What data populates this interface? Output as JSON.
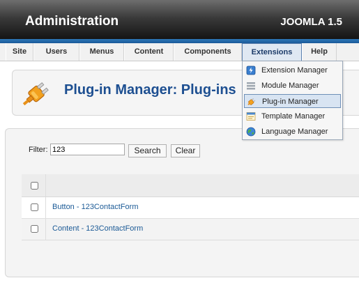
{
  "header": {
    "title": "Administration",
    "version": "JOOMLA 1.5"
  },
  "menu": {
    "items": [
      {
        "label": "Site"
      },
      {
        "label": "Users"
      },
      {
        "label": "Menus"
      },
      {
        "label": "Content"
      },
      {
        "label": "Components"
      },
      {
        "label": "Extensions",
        "active": true
      },
      {
        "label": "Help"
      }
    ]
  },
  "dropdown": {
    "items": [
      {
        "label": "Extension Manager",
        "icon": "extension-manager-icon"
      },
      {
        "label": "Module Manager",
        "icon": "module-manager-icon"
      },
      {
        "label": "Plug-in Manager",
        "icon": "plugin-icon",
        "selected": true
      },
      {
        "label": "Template Manager",
        "icon": "template-manager-icon"
      },
      {
        "label": "Language Manager",
        "icon": "globe-icon"
      }
    ]
  },
  "toolbar": {
    "title": "Plug-in Manager: Plug-ins",
    "icon": "plugin-icon"
  },
  "filter": {
    "label": "Filter:",
    "value": "123",
    "search_label": "Search",
    "clear_label": "Clear"
  },
  "table": {
    "rows": [
      {
        "name": "Button - 123ContactForm"
      },
      {
        "name": "Content - 123ContactForm"
      }
    ]
  },
  "colors": {
    "link": "#1b5a96",
    "title": "#1d4f91",
    "header_strip": "#2e78b8"
  }
}
